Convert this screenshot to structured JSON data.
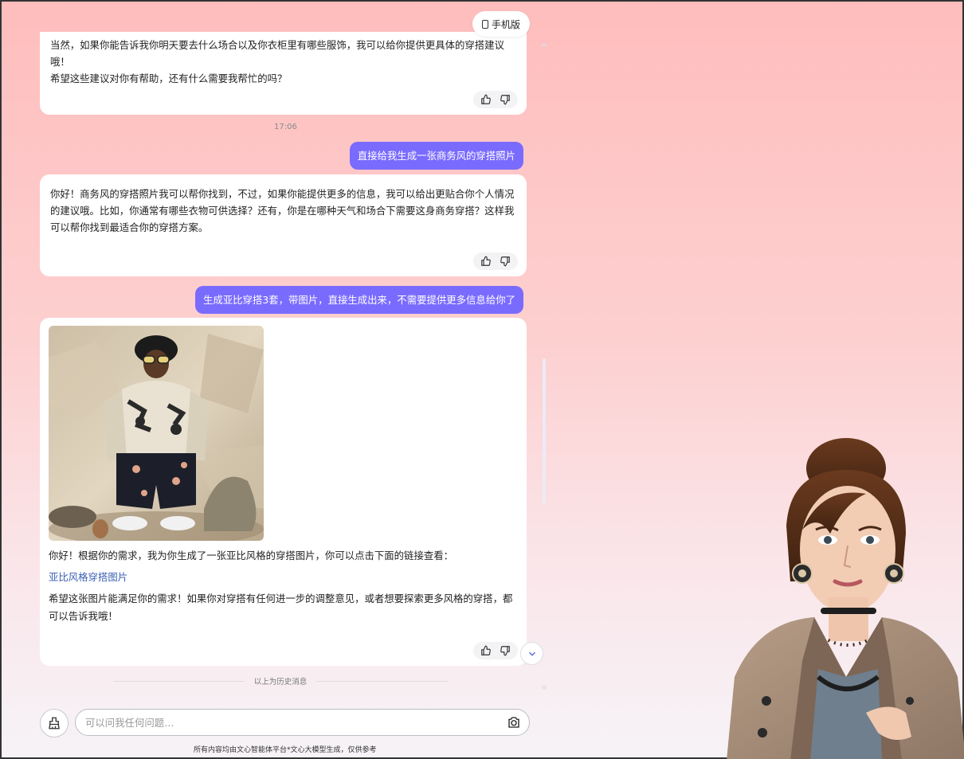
{
  "header": {
    "mobile_label": "手机版"
  },
  "messages": {
    "bot1": {
      "p1": "当然，如果你能告诉我你明天要去什么场合以及你衣柜里有哪些服饰，我可以给你提供更具体的穿搭建议哦！",
      "p2": "希望这些建议对你有帮助，还有什么需要我帮忙的吗？"
    },
    "time": "17:06",
    "user1": "直接给我生成一张商务风的穿搭照片",
    "bot2": {
      "p1": "你好！商务风的穿搭照片我可以帮你找到，不过，如果你能提供更多的信息，我可以给出更贴合你个人情况的建议哦。比如，你通常有哪些衣物可供选择？还有，你是在哪种天气和场合下需要这身商务穿搭？这样我可以帮你找到最适合你的穿搭方案。"
    },
    "user2": "生成亚比穿搭3套，带图片，直接生成出来，不需要提供更多信息给你了",
    "bot3": {
      "p1": "你好！根据你的需求，我为你生成了一张亚比风格的穿搭图片，你可以点击下面的链接查看：",
      "link": "亚比风格穿搭图片",
      "p2": "希望这张图片能满足你的需求！如果你对穿搭有任何进一步的调整意见，或者想要探索更多风格的穿搭，都可以告诉我哦！"
    }
  },
  "history_divider": "以上为历史消息",
  "input": {
    "placeholder": "可以问我任何问题…"
  },
  "footer": "所有内容均由文心智能体平台*文心大模型生成，仅供参考",
  "colors": {
    "accent": "#7a6bff",
    "link": "#3b60b5"
  }
}
